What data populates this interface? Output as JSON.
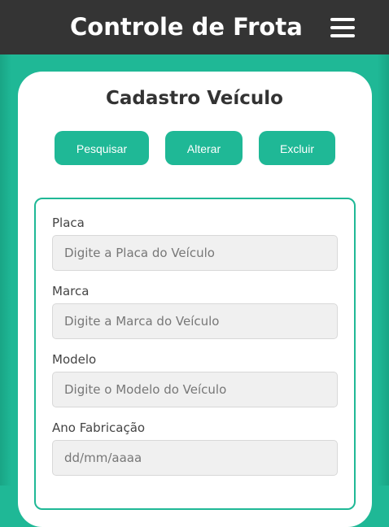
{
  "header": {
    "title": "Controle de Frota",
    "menu_icon": "hamburger-menu-icon"
  },
  "page": {
    "title": "Cadastro Veículo"
  },
  "actions": {
    "search_label": "Pesquisar",
    "edit_label": "Alterar",
    "delete_label": "Excluir"
  },
  "form": {
    "placa": {
      "label": "Placa",
      "placeholder": "Digite a Placa do Veículo",
      "value": ""
    },
    "marca": {
      "label": "Marca",
      "placeholder": "Digite a Marca do Veículo",
      "value": ""
    },
    "modelo": {
      "label": "Modelo",
      "placeholder": "Digite o Modelo do Veículo",
      "value": ""
    },
    "ano": {
      "label": "Ano Fabricação",
      "placeholder": "dd/mm/aaaa",
      "value": ""
    }
  },
  "colors": {
    "accent": "#1fb896",
    "header_bg": "#343434",
    "card_bg": "#ffffff",
    "input_bg": "#f0f0f0"
  }
}
